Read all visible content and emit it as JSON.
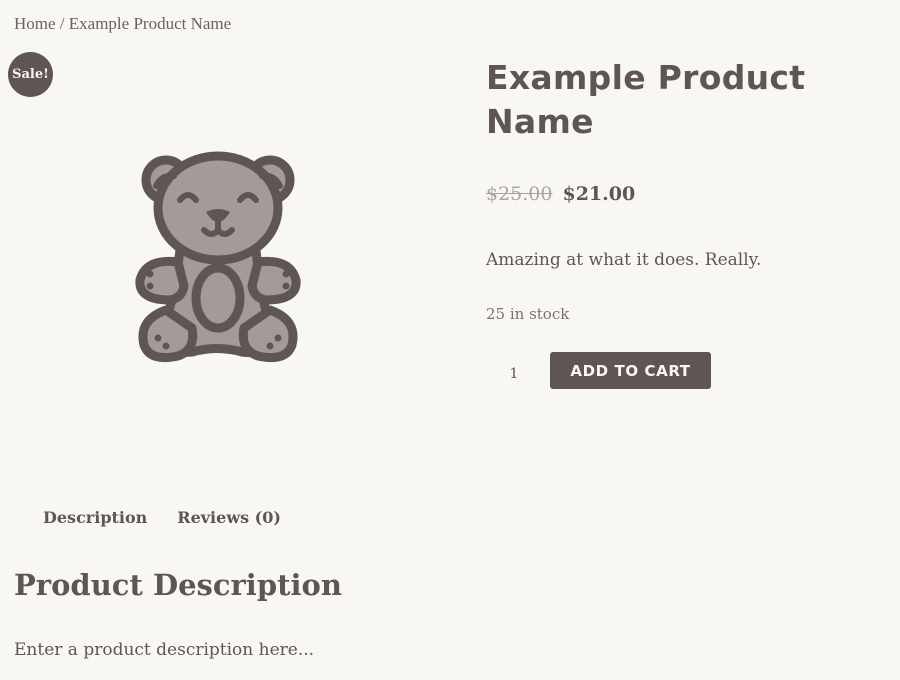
{
  "breadcrumb": {
    "home": "Home",
    "separator": " / ",
    "current": "Example Product Name"
  },
  "badge": {
    "label": "Sale!"
  },
  "image": {
    "icon": "teddy-bear-icon"
  },
  "product": {
    "title": "Example Product Name",
    "price_old": "$25.00",
    "price_new": "$21.00",
    "short_description": "Amazing at what it does. Really.",
    "stock": "25 in stock"
  },
  "cart": {
    "quantity": "1",
    "button_label": "ADD TO CART"
  },
  "tabs": [
    {
      "label": "Description"
    },
    {
      "label": "Reviews (0)"
    }
  ],
  "description": {
    "heading": "Product Description",
    "text": "Enter a product description here..."
  },
  "colors": {
    "background": "#f8f7f2",
    "text": "#5f5654",
    "muted": "#a9a2a0"
  }
}
